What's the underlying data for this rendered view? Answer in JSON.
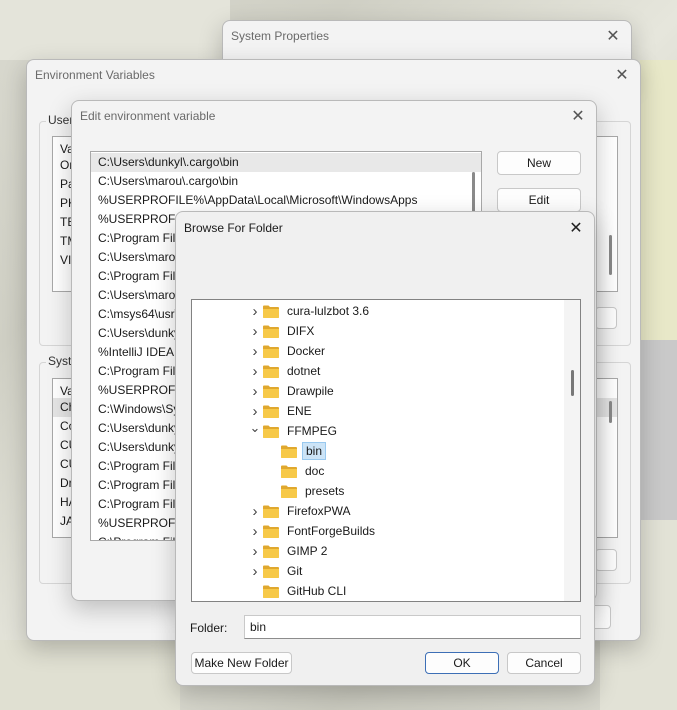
{
  "system_properties": {
    "title": "System Properties"
  },
  "env_vars": {
    "title": "Environment Variables",
    "user_group_label": "User",
    "user_list_header": "Va",
    "user_rows": [
      "Or",
      "Pa",
      "PK",
      "TE",
      "TM",
      "VII"
    ],
    "system_group_label": "Syste",
    "system_list_header": "Va",
    "system_rows": [
      "Ch",
      "Co",
      "CU",
      "CU",
      "Dr",
      "HA",
      "JA"
    ]
  },
  "edit_env": {
    "title": "Edit environment variable",
    "new_label": "New",
    "edit_label": "Edit",
    "paths": [
      "C:\\Users\\dunkyl\\.cargo\\bin",
      "C:\\Users\\marou\\.cargo\\bin",
      "%USERPROFILE%\\AppData\\Local\\Microsoft\\WindowsApps",
      "%USERPROFILE",
      "C:\\Program Fil",
      "C:\\Users\\maro",
      "C:\\Program Fil",
      "C:\\Users\\maro",
      "C:\\msys64\\usr\\",
      "C:\\Users\\dunky",
      "%IntelliJ IDEA C",
      "C:\\Program Fil",
      "%USERPROFILE",
      "C:\\Windows\\Sy",
      "C:\\Users\\dunky",
      "C:\\Users\\dunky",
      "C:\\Program Fil",
      "C:\\Program Fil",
      "C:\\Program Fil",
      "%USERPROFILE",
      "C:\\Program Fil"
    ]
  },
  "browse": {
    "title": "Browse For Folder",
    "folder_label": "Folder:",
    "folder_value": "bin",
    "make_new_folder": "Make New Folder",
    "ok": "OK",
    "cancel": "Cancel",
    "tree": [
      {
        "label": "cura-lulzbot 3.6",
        "level": 0,
        "expander": "collapsed"
      },
      {
        "label": "DIFX",
        "level": 0,
        "expander": "collapsed"
      },
      {
        "label": "Docker",
        "level": 0,
        "expander": "collapsed"
      },
      {
        "label": "dotnet",
        "level": 0,
        "expander": "collapsed"
      },
      {
        "label": "Drawpile",
        "level": 0,
        "expander": "collapsed"
      },
      {
        "label": "ENE",
        "level": 0,
        "expander": "collapsed"
      },
      {
        "label": "FFMPEG",
        "level": 0,
        "expander": "expanded"
      },
      {
        "label": "bin",
        "level": 1,
        "expander": "none",
        "selected": true
      },
      {
        "label": "doc",
        "level": 1,
        "expander": "none"
      },
      {
        "label": "presets",
        "level": 1,
        "expander": "none"
      },
      {
        "label": "FirefoxPWA",
        "level": 0,
        "expander": "collapsed"
      },
      {
        "label": "FontForgeBuilds",
        "level": 0,
        "expander": "collapsed"
      },
      {
        "label": "GIMP 2",
        "level": 0,
        "expander": "collapsed"
      },
      {
        "label": "Git",
        "level": 0,
        "expander": "collapsed"
      },
      {
        "label": "GitHub CLI",
        "level": 0,
        "expander": "none"
      }
    ]
  },
  "colors": {
    "folder_fill": "#f7c948",
    "folder_tab": "#e0a82e",
    "selection_bg": "#cce4f7",
    "default_button_border": "#3d6fb6"
  }
}
